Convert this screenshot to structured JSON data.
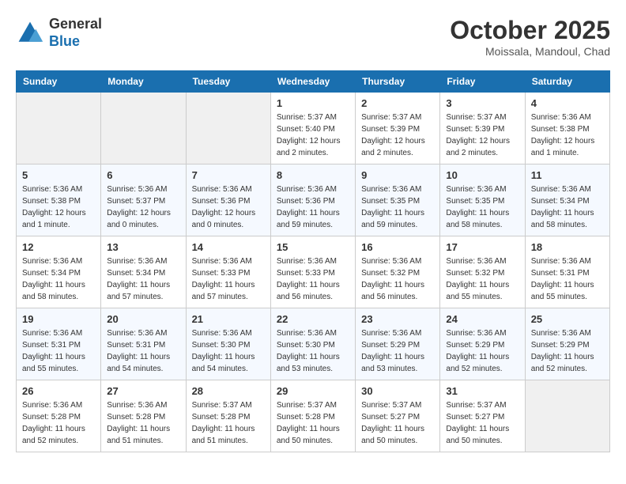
{
  "header": {
    "logo_general": "General",
    "logo_blue": "Blue",
    "month": "October 2025",
    "location": "Moissala, Mandoul, Chad"
  },
  "weekdays": [
    "Sunday",
    "Monday",
    "Tuesday",
    "Wednesday",
    "Thursday",
    "Friday",
    "Saturday"
  ],
  "weeks": [
    [
      {
        "day": "",
        "info": ""
      },
      {
        "day": "",
        "info": ""
      },
      {
        "day": "",
        "info": ""
      },
      {
        "day": "1",
        "info": "Sunrise: 5:37 AM\nSunset: 5:40 PM\nDaylight: 12 hours\nand 2 minutes."
      },
      {
        "day": "2",
        "info": "Sunrise: 5:37 AM\nSunset: 5:39 PM\nDaylight: 12 hours\nand 2 minutes."
      },
      {
        "day": "3",
        "info": "Sunrise: 5:37 AM\nSunset: 5:39 PM\nDaylight: 12 hours\nand 2 minutes."
      },
      {
        "day": "4",
        "info": "Sunrise: 5:36 AM\nSunset: 5:38 PM\nDaylight: 12 hours\nand 1 minute."
      }
    ],
    [
      {
        "day": "5",
        "info": "Sunrise: 5:36 AM\nSunset: 5:38 PM\nDaylight: 12 hours\nand 1 minute."
      },
      {
        "day": "6",
        "info": "Sunrise: 5:36 AM\nSunset: 5:37 PM\nDaylight: 12 hours\nand 0 minutes."
      },
      {
        "day": "7",
        "info": "Sunrise: 5:36 AM\nSunset: 5:36 PM\nDaylight: 12 hours\nand 0 minutes."
      },
      {
        "day": "8",
        "info": "Sunrise: 5:36 AM\nSunset: 5:36 PM\nDaylight: 11 hours\nand 59 minutes."
      },
      {
        "day": "9",
        "info": "Sunrise: 5:36 AM\nSunset: 5:35 PM\nDaylight: 11 hours\nand 59 minutes."
      },
      {
        "day": "10",
        "info": "Sunrise: 5:36 AM\nSunset: 5:35 PM\nDaylight: 11 hours\nand 58 minutes."
      },
      {
        "day": "11",
        "info": "Sunrise: 5:36 AM\nSunset: 5:34 PM\nDaylight: 11 hours\nand 58 minutes."
      }
    ],
    [
      {
        "day": "12",
        "info": "Sunrise: 5:36 AM\nSunset: 5:34 PM\nDaylight: 11 hours\nand 58 minutes."
      },
      {
        "day": "13",
        "info": "Sunrise: 5:36 AM\nSunset: 5:34 PM\nDaylight: 11 hours\nand 57 minutes."
      },
      {
        "day": "14",
        "info": "Sunrise: 5:36 AM\nSunset: 5:33 PM\nDaylight: 11 hours\nand 57 minutes."
      },
      {
        "day": "15",
        "info": "Sunrise: 5:36 AM\nSunset: 5:33 PM\nDaylight: 11 hours\nand 56 minutes."
      },
      {
        "day": "16",
        "info": "Sunrise: 5:36 AM\nSunset: 5:32 PM\nDaylight: 11 hours\nand 56 minutes."
      },
      {
        "day": "17",
        "info": "Sunrise: 5:36 AM\nSunset: 5:32 PM\nDaylight: 11 hours\nand 55 minutes."
      },
      {
        "day": "18",
        "info": "Sunrise: 5:36 AM\nSunset: 5:31 PM\nDaylight: 11 hours\nand 55 minutes."
      }
    ],
    [
      {
        "day": "19",
        "info": "Sunrise: 5:36 AM\nSunset: 5:31 PM\nDaylight: 11 hours\nand 55 minutes."
      },
      {
        "day": "20",
        "info": "Sunrise: 5:36 AM\nSunset: 5:31 PM\nDaylight: 11 hours\nand 54 minutes."
      },
      {
        "day": "21",
        "info": "Sunrise: 5:36 AM\nSunset: 5:30 PM\nDaylight: 11 hours\nand 54 minutes."
      },
      {
        "day": "22",
        "info": "Sunrise: 5:36 AM\nSunset: 5:30 PM\nDaylight: 11 hours\nand 53 minutes."
      },
      {
        "day": "23",
        "info": "Sunrise: 5:36 AM\nSunset: 5:29 PM\nDaylight: 11 hours\nand 53 minutes."
      },
      {
        "day": "24",
        "info": "Sunrise: 5:36 AM\nSunset: 5:29 PM\nDaylight: 11 hours\nand 52 minutes."
      },
      {
        "day": "25",
        "info": "Sunrise: 5:36 AM\nSunset: 5:29 PM\nDaylight: 11 hours\nand 52 minutes."
      }
    ],
    [
      {
        "day": "26",
        "info": "Sunrise: 5:36 AM\nSunset: 5:28 PM\nDaylight: 11 hours\nand 52 minutes."
      },
      {
        "day": "27",
        "info": "Sunrise: 5:36 AM\nSunset: 5:28 PM\nDaylight: 11 hours\nand 51 minutes."
      },
      {
        "day": "28",
        "info": "Sunrise: 5:37 AM\nSunset: 5:28 PM\nDaylight: 11 hours\nand 51 minutes."
      },
      {
        "day": "29",
        "info": "Sunrise: 5:37 AM\nSunset: 5:28 PM\nDaylight: 11 hours\nand 50 minutes."
      },
      {
        "day": "30",
        "info": "Sunrise: 5:37 AM\nSunset: 5:27 PM\nDaylight: 11 hours\nand 50 minutes."
      },
      {
        "day": "31",
        "info": "Sunrise: 5:37 AM\nSunset: 5:27 PM\nDaylight: 11 hours\nand 50 minutes."
      },
      {
        "day": "",
        "info": ""
      }
    ]
  ]
}
